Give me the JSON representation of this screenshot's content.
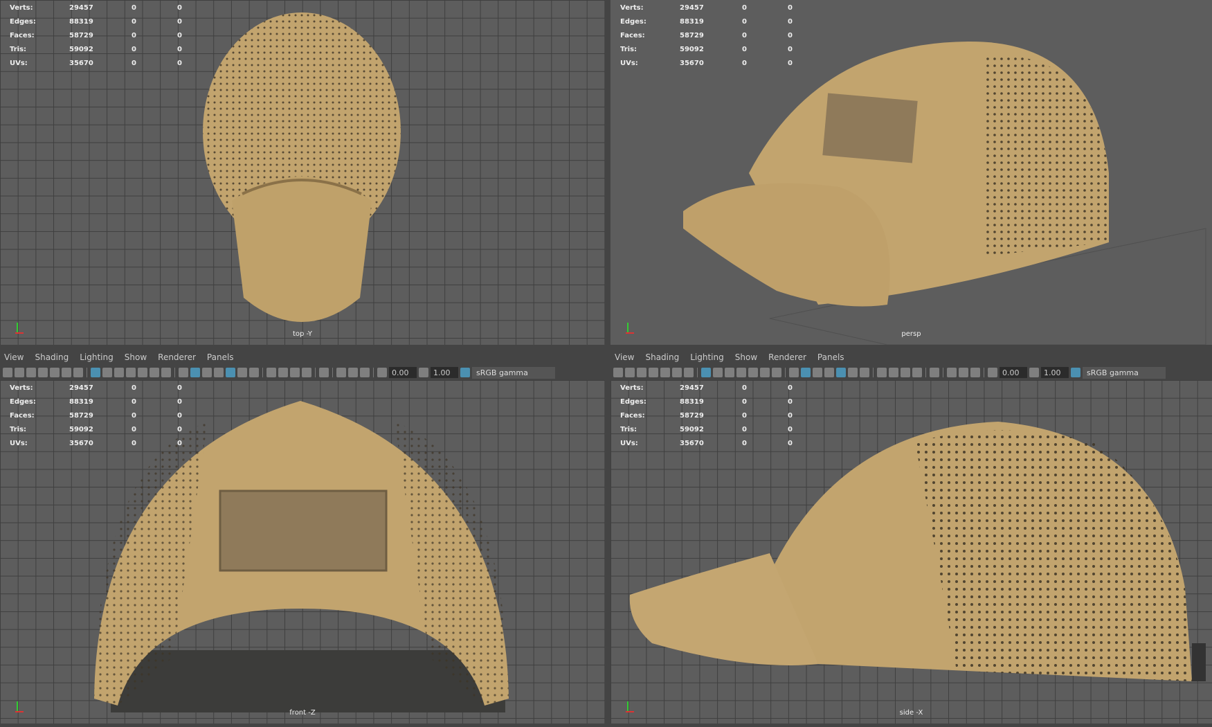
{
  "stats": [
    {
      "label": "Verts:",
      "value": "29457",
      "sel": "0",
      "sel2": "0"
    },
    {
      "label": "Edges:",
      "value": "88319",
      "sel": "0",
      "sel2": "0"
    },
    {
      "label": "Faces:",
      "value": "58729",
      "sel": "0",
      "sel2": "0"
    },
    {
      "label": "Tris:",
      "value": "59092",
      "sel": "0",
      "sel2": "0"
    },
    {
      "label": "UVs:",
      "value": "35670",
      "sel": "0",
      "sel2": "0"
    }
  ],
  "menu": [
    "View",
    "Shading",
    "Lighting",
    "Show",
    "Renderer",
    "Panels"
  ],
  "toolbar": {
    "exposure": "0.00",
    "gamma": "1.00",
    "color_space": "sRGB gamma",
    "icons": [
      "camera",
      "camera-lock",
      "camera-attr",
      "bookmark",
      "image-plane",
      "grease-pencil",
      "2d-pan",
      "sep",
      "grid",
      "film-gate",
      "resolution-gate",
      "gate-mask",
      "field-chart",
      "safe-action",
      "safe-title",
      "sep",
      "wireframe",
      "smooth-shade",
      "default-material",
      "wireframe-on-shaded",
      "xray",
      "use-lights",
      "shadows",
      "sep",
      "ambient-occlusion",
      "motion-blur",
      "anti-alias",
      "depth-of-field",
      "sep",
      "isolate-select",
      "sep",
      "xray-joints",
      "xray-active",
      "backface",
      "sep"
    ],
    "active": [
      "grid",
      "smooth-shade",
      "xray"
    ]
  },
  "viewports": [
    {
      "camera": "top -Y"
    },
    {
      "camera": "persp"
    },
    {
      "camera": "front -Z"
    },
    {
      "camera": "side -X"
    }
  ],
  "colors": {
    "cap": "#c2a46e",
    "cap_dark": "#9a7f4f",
    "patch": "#8f7a5a",
    "active_icon": "#4c9ec4"
  }
}
